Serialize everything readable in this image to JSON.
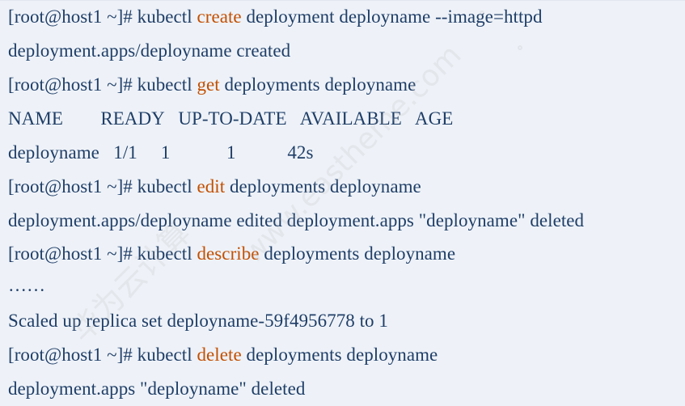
{
  "terminal": {
    "lines": [
      {
        "prompt": "[root@host1 ~]# ",
        "cmd": "kubectl ",
        "verb": "create",
        "rest": " deployment deployname --image=httpd"
      },
      {
        "output": "deployment.apps/deployname created"
      },
      {
        "prompt": "[root@host1 ~]# ",
        "cmd": "kubectl ",
        "verb": "get",
        "rest": " deployments deployname"
      },
      {
        "output": "NAME        READY   UP-TO-DATE   AVAILABLE   AGE"
      },
      {
        "output": "deployname   1/1     1            1           42s"
      },
      {
        "prompt": "[root@host1 ~]# ",
        "cmd": "kubectl ",
        "verb": "edit",
        "rest": " deployments deployname"
      },
      {
        "output": "deployment.apps/deployname edited deployment.apps \"deployname\" deleted"
      },
      {
        "prompt": "[root@host1 ~]# ",
        "cmd": "kubectl ",
        "verb": "describe",
        "rest": " deployments deployname"
      },
      {
        "output": "……"
      },
      {
        "output": "Scaled up replica set deployname-59f4956778 to 1"
      },
      {
        "prompt": "[root@host1 ~]# ",
        "cmd": "kubectl ",
        "verb": "delete",
        "rest": " deployments deployname"
      },
      {
        "output": "deployment.apps \"deployname\" deleted"
      }
    ]
  },
  "watermark": {
    "chinese": "华为云计算",
    "english": "www.eastheme.com"
  },
  "colors": {
    "background": "#eef2f8",
    "text": "#1f3e67",
    "verb": "#c34f00"
  }
}
